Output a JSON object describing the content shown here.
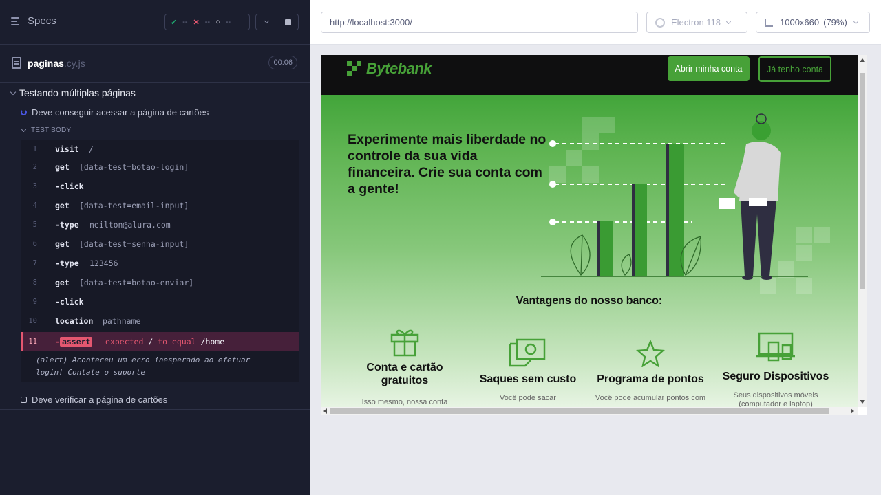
{
  "reporter": {
    "specs_label": "Specs",
    "stats": {
      "passed": "--",
      "failed": "--",
      "pending": "--"
    },
    "spec": {
      "name": "paginas",
      "ext": ".cy.js",
      "duration": "00:06"
    },
    "suite_title": "Testando múltiplas páginas",
    "test1_title": "Deve conseguir acessar a página de cartões",
    "test_body_label": "TEST BODY",
    "commands": [
      {
        "num": "1",
        "name": "visit",
        "message": "/"
      },
      {
        "num": "2",
        "name": "get",
        "message": "[data-test=botao-login]"
      },
      {
        "num": "3",
        "name": "-click",
        "message": ""
      },
      {
        "num": "4",
        "name": "get",
        "message": "[data-test=email-input]"
      },
      {
        "num": "5",
        "name": "-type",
        "message": "neilton@alura.com"
      },
      {
        "num": "6",
        "name": "get",
        "message": "[data-test=senha-input]"
      },
      {
        "num": "7",
        "name": "-type",
        "message": "123456"
      },
      {
        "num": "8",
        "name": "get",
        "message": "[data-test=botao-enviar]"
      },
      {
        "num": "9",
        "name": "-click",
        "message": ""
      },
      {
        "num": "10",
        "name": "location",
        "message": "pathname"
      }
    ],
    "failed_command": {
      "num": "11",
      "dash": "-",
      "name": "assert",
      "expected": "expected",
      "actual": "/",
      "op": "to equal",
      "target": "/home"
    },
    "alert_message": "(alert)  Aconteceu um erro inesperado ao efetuar login! Contate o suporte",
    "test2_title": "Deve verificar a página de cartões"
  },
  "aut": {
    "url": "http://localhost:3000/",
    "browser": "Electron 118",
    "viewport": "1000x660",
    "scale": "(79%)"
  },
  "site": {
    "brand": "Bytebank",
    "open_account": "Abrir minha conta",
    "have_account": "Já tenho conta",
    "hero_title": "Experimente mais liberdade no controle da sua vida financeira. Crie sua conta com a gente!",
    "advantages_title": "Vantagens do nosso banco:",
    "cards": [
      {
        "title": "Conta e cartão gratuitos",
        "desc": "Isso mesmo, nossa conta é",
        "icon": "gift-icon"
      },
      {
        "title": "Saques sem custo",
        "desc": "Você pode sacar gratuitamente Ao por mês de qualquer Banco",
        "icon": "cash-icon"
      },
      {
        "title": "Programa de pontos",
        "desc": "Você pode acumular pontos com suas compras no crédito",
        "icon": "star-icon"
      },
      {
        "title": "Seguro Dispositivos",
        "desc": "Seus dispositivos móveis (computador e laptop)",
        "icon": "devices-icon"
      }
    ]
  },
  "colors": {
    "brand_green": "#47a138",
    "fail_red": "#e45770",
    "reporter_bg": "#1b1e2e"
  }
}
